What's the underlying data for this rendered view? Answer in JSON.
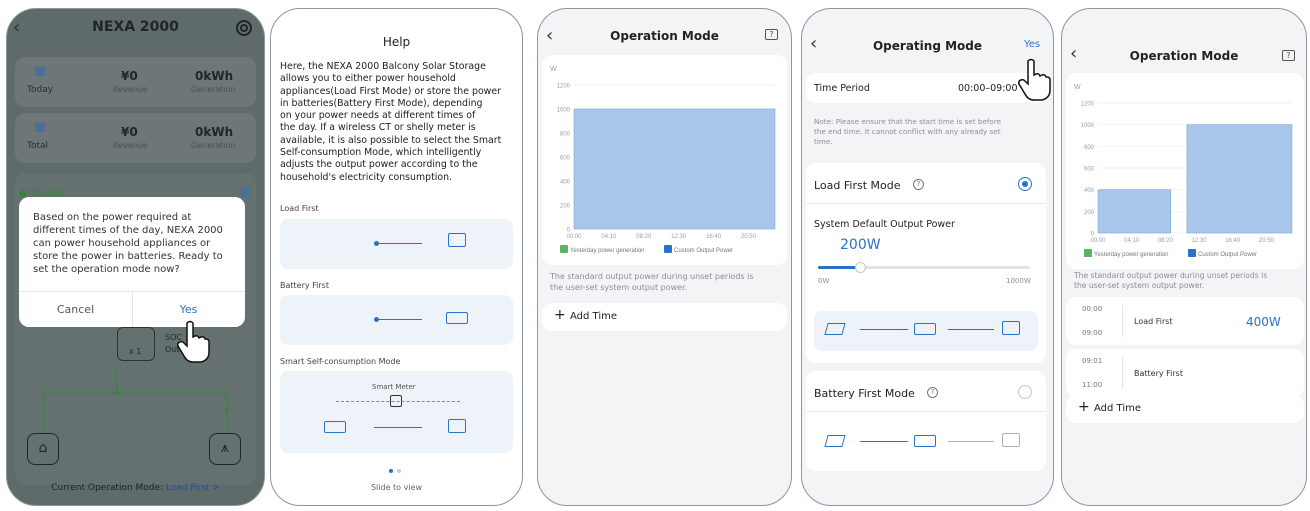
{
  "colors": {
    "accent": "#2a71c8",
    "bar": "#a8c6ea",
    "green": "#38a34a",
    "dim": "#5f6a6a"
  },
  "p1": {
    "title": "NEXA 2000",
    "today": {
      "revenue": "¥0",
      "revenue_label": "Revenue",
      "gen": "0kWh",
      "gen_label": "Generation",
      "label": "Today"
    },
    "total": {
      "revenue": "¥0",
      "revenue_label": "Revenue",
      "gen": "0kWh",
      "gen_label": "Generation",
      "label": "Total"
    },
    "status": "● On-grid",
    "battery_count": "x 1",
    "soc": "SOC",
    "out": "Out",
    "dialog": {
      "message": "Based on the power required at different times of the day, NEXA 2000 can power household appliances or store the power in batteries. Ready to set the operation mode now?",
      "cancel": "Cancel",
      "yes": "Yes"
    },
    "current_mode_prefix": "Current Operation Mode:",
    "current_mode": "Load First",
    "chevron": ">"
  },
  "p2": {
    "title": "Help",
    "body": "Here, the NEXA 2000 Balcony Solar Storage allows you to either power household appliances(Load First Mode) or store the power in batteries(Battery First Mode), depending on your power needs at different times of the day. If a wireless CT or shelly meter is available, it is also possible to select the Smart Self-consumption Mode, which intelligently adjusts the output power according to the household's electricity consumption.",
    "body_lines": [
      "Here, the NEXA 2000 Balcony Solar Storage",
      "allows you to either power household",
      "appliances(Load First Mode) or store the power",
      "in batteries(Battery First Mode), depending",
      "on your power needs at different times of",
      "the day. If a wireless CT or shelly meter is",
      "available, it is also possible to select the Smart",
      "Self-consumption Mode, which intelligently",
      "adjusts the output power according to the",
      "household's electricity consumption."
    ],
    "sections": [
      "Load First",
      "Battery First",
      "Smart Self-consumption Mode"
    ],
    "smart_meter": "Smart Meter",
    "slide": "Slide to view"
  },
  "p3": {
    "title": "Operation Mode",
    "unit": "W",
    "note": "The standard output power during unset periods is the user-set system output power.",
    "note_lines": [
      "The standard output power during unset periods is",
      "the user-set system output power."
    ],
    "add_time": "Add Time",
    "legend": [
      "Yesterday power generation",
      "Custom Output Power"
    ]
  },
  "p4": {
    "title": "Operating Mode",
    "yes": "Yes",
    "time_period_label": "Time Period",
    "time_period": "00:00–09:00",
    "note": "Note: Please ensure that the start time is set before the end time. It cannot conflict with any already set time.",
    "note_lines": [
      "Note: Please ensure that the start time is set before",
      "the end time. It cannot conflict with any already set",
      "time."
    ],
    "load_first": "Load First Mode",
    "default_power_label": "System Default Output Power",
    "default_power": "200W",
    "slider_min": "0W",
    "slider_max": "1000W",
    "slider_level": 0.2,
    "battery_first": "Battery First Mode"
  },
  "p5": {
    "title": "Operation Mode",
    "unit": "W",
    "note_lines": [
      "The standard output power during unset periods is",
      "the user-set system output power."
    ],
    "note": "The standard output power during unset periods is the user-set system output power.",
    "legend": [
      "Yesterday power generation",
      "Custom Output Power"
    ],
    "rows": [
      {
        "start": "00:00",
        "end": "09:00",
        "mode": "Load First",
        "power": "400W"
      },
      {
        "start": "09:01",
        "end": "11:00",
        "mode": "Battery First",
        "power": ""
      }
    ],
    "add_time": "Add Time"
  },
  "chart_data": [
    {
      "type": "bar",
      "title": "",
      "ylabel": "W",
      "ylim": [
        0,
        1200
      ],
      "yticks": [
        0,
        200,
        400,
        600,
        800,
        1000,
        1200
      ],
      "xticks": [
        "00:00",
        "04:10",
        "08:20",
        "12:30",
        "16:40",
        "20:50"
      ],
      "series": [
        {
          "name": "Custom Output Power",
          "segments": [
            {
              "from": "00:00",
              "to": "24:00",
              "value": 1000
            }
          ]
        },
        {
          "name": "Yesterday power generation",
          "segments": []
        }
      ]
    },
    {
      "type": "bar",
      "title": "",
      "ylabel": "W",
      "ylim": [
        0,
        1200
      ],
      "yticks": [
        0,
        200,
        400,
        600,
        800,
        1000,
        1200
      ],
      "xticks": [
        "00:00",
        "04:10",
        "08:20",
        "12:30",
        "16:40",
        "20:50"
      ],
      "series": [
        {
          "name": "Custom Output Power",
          "segments": [
            {
              "from": "00:00",
              "to": "09:00",
              "value": 400
            },
            {
              "from": "11:00",
              "to": "24:00",
              "value": 1000
            }
          ]
        },
        {
          "name": "Yesterday power generation",
          "segments": []
        }
      ]
    }
  ]
}
